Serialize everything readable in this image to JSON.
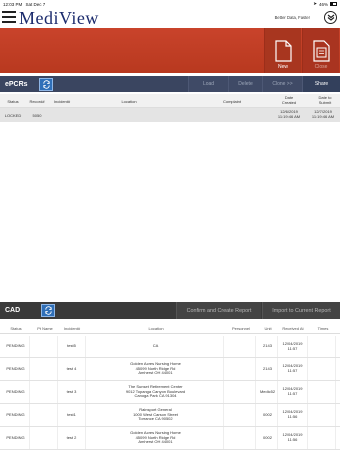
{
  "status_bar": {
    "time": "12:03 PM",
    "date": "Sat Dec 7",
    "battery": "46%"
  },
  "header": {
    "logo": "MediView",
    "tagline": "Better Data, Faster"
  },
  "banner": {
    "new_label": "New",
    "close_label": "Close"
  },
  "epcrs": {
    "title": "ePCRs",
    "buttons": {
      "load": "Load",
      "delete": "Delete",
      "clone": "Clone >>",
      "share": "Share"
    },
    "columns": {
      "status": "Status",
      "record": "Record#",
      "incident": "Incident#",
      "location": "Location",
      "complaint": "Complaint",
      "created": "Date Created",
      "submit": "Date to Submit"
    },
    "rows": [
      {
        "status": "LOCKED",
        "record": "5050",
        "incident": "",
        "location": "",
        "complaint": "",
        "created": "12/6/2019 11:19:46 AM",
        "submit": "12/7/2019 11:19:46 AM"
      }
    ]
  },
  "cad": {
    "title": "CAD",
    "buttons": {
      "confirm": "Confirm and Create Report",
      "import": "Import to Current Report"
    },
    "columns": {
      "status": "Status",
      "pt_name": "Pt Name",
      "incident": "Incident#",
      "location": "Location",
      "personnel": "Personnel",
      "unit": "Unit",
      "received": "Received At",
      "times": "Times"
    },
    "rows": [
      {
        "status": "PENDING",
        "pt_name": "",
        "incident": "test5",
        "location": "CA",
        "personnel": "",
        "unit": "2143",
        "received": "12/04/2019 11:57",
        "times": ""
      },
      {
        "status": "PENDING",
        "pt_name": "",
        "incident": "test 4",
        "location": "Golden Acres Nursing Home\n45099 North Ridge Rd\nAmherst OH 44001",
        "personnel": "",
        "unit": "2143",
        "received": "12/04/2019 11:57",
        "times": ""
      },
      {
        "status": "PENDING",
        "pt_name": "",
        "incident": "test 3",
        "location": "The Sunset Retirement Center\n9012 Topanga Canyon Boulevard\nCanoga Park CA 91304",
        "personnel": "",
        "unit": "Medic52",
        "received": "12/04/2019 11:57",
        "times": ""
      },
      {
        "status": "PENDING",
        "pt_name": "",
        "incident": "test1",
        "location": "Rainsport General\n1000 West Carson Street\nTorrance CA 90502",
        "personnel": "",
        "unit": "0002",
        "received": "12/04/2019 11:56",
        "times": ""
      },
      {
        "status": "PENDING",
        "pt_name": "",
        "incident": "test 2",
        "location": "Golden Acres Nursing Home\n45099 North Ridge Rd\nAmherst OH 44001",
        "personnel": "",
        "unit": "0002",
        "received": "12/04/2019 11:56",
        "times": ""
      }
    ]
  }
}
